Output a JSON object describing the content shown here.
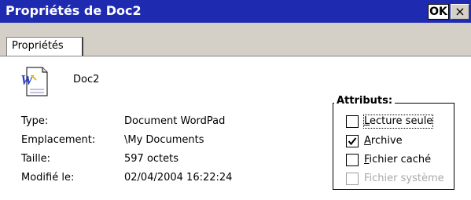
{
  "window": {
    "title": "Propriétés de Doc2",
    "ok_label": "OK",
    "close_label": "×"
  },
  "tabs": [
    {
      "label": "Propriétés",
      "active": true
    }
  ],
  "document": {
    "icon": "wordpad-document-icon",
    "name": "Doc2"
  },
  "properties": [
    {
      "label": "Type:",
      "value": "Document WordPad"
    },
    {
      "label": "Emplacement:",
      "value": "\\My Documents"
    },
    {
      "label": "Taille:",
      "value": "597 octets"
    },
    {
      "label": "Modifié le:",
      "value": "02/04/2004 16:22:24"
    }
  ],
  "attributes": {
    "legend": "Attributs:",
    "items": [
      {
        "label": "Lecture seule",
        "checked": false,
        "enabled": true
      },
      {
        "label": "Archive",
        "checked": true,
        "enabled": true
      },
      {
        "label": "Fichier caché",
        "checked": false,
        "enabled": true
      },
      {
        "label": "Fichier système",
        "checked": false,
        "enabled": false
      }
    ]
  },
  "colors": {
    "titlebar": "#1e2bb1",
    "dialog_bg": "#d4d0c8",
    "panel_bg": "#ffffff",
    "disabled_text": "#a8a8a8"
  }
}
